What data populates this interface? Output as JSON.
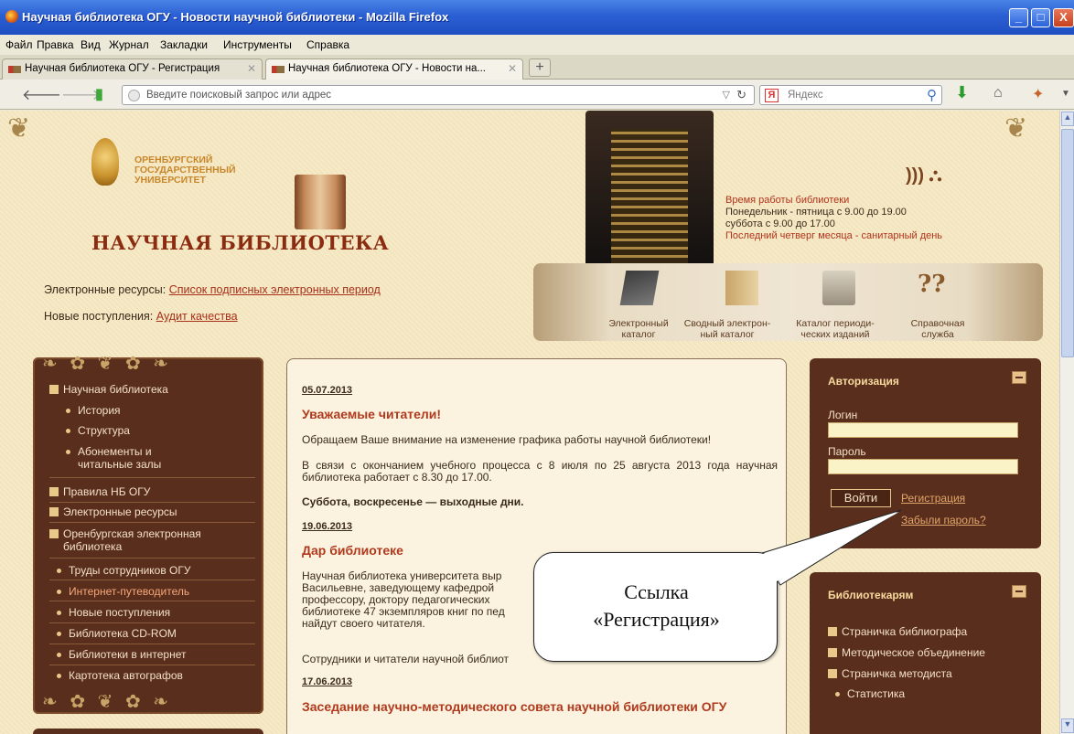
{
  "window": {
    "title": "Научная библиотека ОГУ - Новости научной библиотеки - Mozilla Firefox",
    "minimize": "_",
    "maximize": "□",
    "close": "X"
  },
  "menu": [
    "Файл",
    "Правка",
    "Вид",
    "Журнал",
    "Закладки",
    "Инструменты",
    "Справка"
  ],
  "tabs": [
    {
      "label": "Научная библиотека ОГУ - Регистрация"
    },
    {
      "label": "Научная библиотека ОГУ - Новости на..."
    }
  ],
  "newtab": "+",
  "navbar": {
    "url_placeholder": "Введите поисковый запрос или адрес",
    "search_placeholder": "Яндекс",
    "yandex_badge": "Я"
  },
  "header": {
    "org_line1": "ОРЕНБУРГСКИЙ",
    "org_line2": "ГОСУДАРСТВЕННЫЙ",
    "org_line3": "УНИВЕРСИТЕТ",
    "library_name": "НАУЧНАЯ БИБЛИОТЕКА",
    "hours_title": "Время работы библиотеки",
    "hours_line1": "Понедельник - пятница с 9.00 до 19.00",
    "hours_line2": "суббота с 9.00 до 17.00",
    "hours_line3": "Последний четверг месяца - санитарный день"
  },
  "resources": {
    "label": "Электронные ресурсы:",
    "link": "Список подписных электронных период",
    "new_label": "Новые поступления:",
    "new_link": "Аудит качества"
  },
  "banner": [
    {
      "line1": "Электронный",
      "line2": "каталог"
    },
    {
      "line1": "Сводный электрон-",
      "line2": "ный каталог"
    },
    {
      "line1": "Каталог периоди-",
      "line2": "ческих изданий"
    },
    {
      "line1": "Справочная",
      "line2": "служба"
    }
  ],
  "sidebar": {
    "items": [
      {
        "label": "Научная библиотека"
      },
      {
        "label": "История"
      },
      {
        "label": "Структура"
      },
      {
        "label": "Абонементы и"
      },
      {
        "label": "читальные залы"
      },
      {
        "label": "Правила НБ ОГУ"
      },
      {
        "label": "Электронные ресурсы"
      },
      {
        "label": "Оренбургская электронная"
      },
      {
        "label": "библиотека"
      },
      {
        "label": "Труды сотрудников ОГУ"
      },
      {
        "label": "Интернет-путеводитель"
      },
      {
        "label": "Новые поступления"
      },
      {
        "label": "Библиотека CD-ROM"
      },
      {
        "label": "Библиотеки в интернет"
      },
      {
        "label": "Картотека автографов"
      }
    ]
  },
  "news": [
    {
      "date": "05.07.2013",
      "title": "Уважаемые читатели!",
      "p1": "Обращаем Ваше внимание на изменение графика работы научной библиотеки!",
      "p2": "В связи с окончанием учебного процесса с 8 июля по 25 августа 2013 года научная библиотека работает с 8.30 до 17.00.",
      "p3": "Суббота, воскресенье — выходные дни."
    },
    {
      "date": "19.06.2013",
      "title": "Дар библиотеке",
      "l1": "Научная библиотека университета выр",
      "l2": "Васильевне, заведующему кафедрой",
      "l3": "профессору, доктору педагогических",
      "l4": "библиотеке 47 экземпляров книг по пед",
      "l5": "найдут своего читателя.",
      "p2": "Сотрудники и читатели научной библиот"
    },
    {
      "date": "17.06.2013",
      "title": "Заседание научно-методического совета научной библиотеки ОГУ"
    }
  ],
  "auth": {
    "title": "Авторизация",
    "login_label": "Логин",
    "password_label": "Пароль",
    "login_button": "Войти",
    "register_link": "Регистрация",
    "forgot_link": "Забыли пароль?"
  },
  "librarians": {
    "title": "Библиотекарям",
    "items": [
      "Страничка библиографа",
      "Методическое объединение",
      "Страничка методиста",
      "Статистика"
    ]
  },
  "callout": {
    "line1": "Ссылка",
    "line2": "«Регистрация»"
  }
}
